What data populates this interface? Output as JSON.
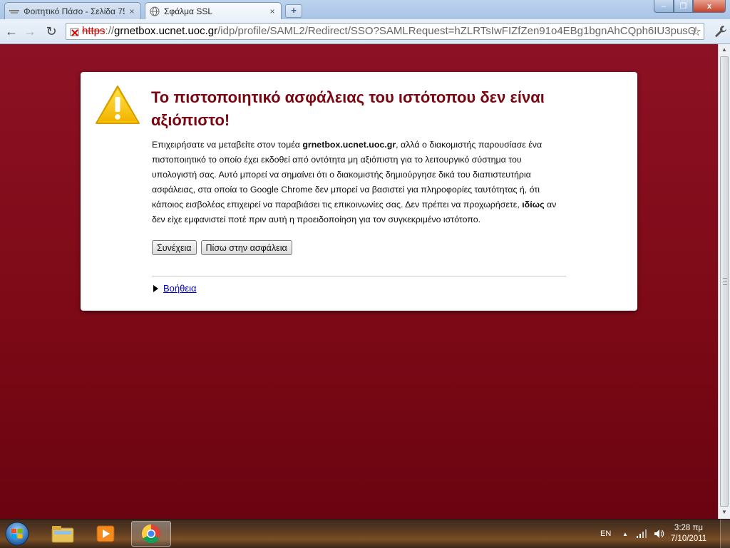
{
  "browser": {
    "tabs": [
      {
        "title": "Φοιτητικό Πάσο - Σελίδα 75",
        "active": false
      },
      {
        "title": "Σφάλμα SSL",
        "active": true
      }
    ],
    "close_glyph": "×",
    "newtab_glyph": "+",
    "window_controls": {
      "minimize": "‒",
      "maximize": "❐",
      "close": "x"
    },
    "nav": {
      "back": "←",
      "forward": "→",
      "reload": "↻",
      "star": "☆"
    },
    "url": {
      "scheme": "https",
      "sep": "://",
      "host": "grnetbox.ucnet.uoc.gr",
      "path": "/idp/profile/SAML2/Redirect/SSO?SAMLRequest=hZLRTsIwFIZfZen91o4EBg1bgnAhCQph6IU3pusO"
    }
  },
  "page": {
    "heading": "Το πιστοποιητικό ασφάλειας του ιστότοπου δεν είναι αξιόπιστο!",
    "body_pre": "Επιχειρήσατε να μεταβείτε στον τομέα ",
    "body_domain": "grnetbox.ucnet.uoc.gr",
    "body_mid": ", αλλά ο διακομιστής παρουσίασε ένα πιστοποιητικό το οποίο έχει εκδοθεί από οντότητα μη αξιόπιστη για το λειτουργικό σύστημα του υπολογιστή σας. Αυτό μπορεί να σημαίνει ότι ο διακομιστής δημιούργησε δικά του διαπιστευτήρια ασφάλειας, στα οποία το Google Chrome δεν μπορεί να βασιστεί για πληροφορίες ταυτότητας ή, ότι κάποιος εισβολέας επιχειρεί να παραβιάσει τις επικοινωνίες σας. Δεν πρέπει να προχωρήσετε, ",
    "body_emph": "ιδίως",
    "body_post": " αν δεν είχε εμφανιστεί ποτέ πριν αυτή η προειδοποίηση για τον συγκεκριμένο ιστότοπο.",
    "proceed_label": "Συνέχεια",
    "back_label": "Πίσω στην ασφάλεια",
    "help_label": "Βοήθεια"
  },
  "taskbar": {
    "language": "EN",
    "tray_arrow": "▲",
    "time": "3:28 πμ",
    "date": "7/10/2011"
  },
  "colors": {
    "page_bg": "#8c1124",
    "heading": "#7a0612",
    "link": "#0000cc",
    "warning_yellow": "#f7c600"
  }
}
